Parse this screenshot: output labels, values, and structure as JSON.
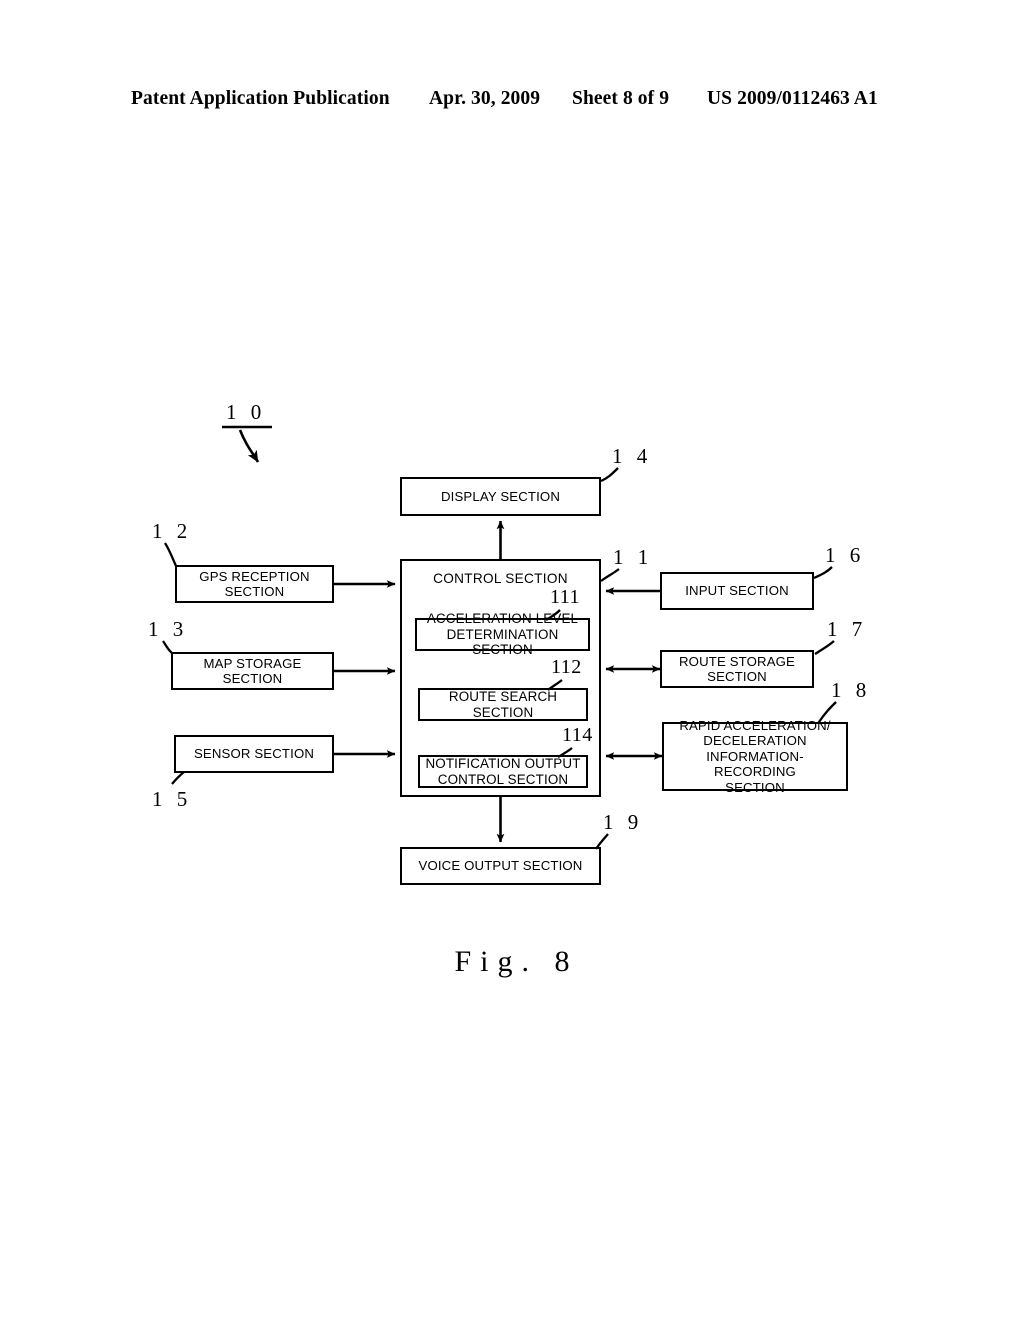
{
  "header": {
    "publication": "Patent Application Publication",
    "date": "Apr. 30, 2009",
    "sheet": "Sheet 8 of 9",
    "number": "US 2009/0112463 A1"
  },
  "figure": {
    "caption": "Fig. 8",
    "system_ref": "1 0"
  },
  "blocks": {
    "display": {
      "label": "DISPLAY SECTION",
      "ref": "1 4"
    },
    "control": {
      "label": "CONTROL SECTION",
      "ref": "1 1"
    },
    "acceleration_level": {
      "label": "ACCELERATION LEVEL\nDETERMINATION SECTION",
      "ref": "111"
    },
    "route_search": {
      "label": "ROUTE SEARCH\nSECTION",
      "ref": "112"
    },
    "notification_output": {
      "label": "NOTIFICATION OUTPUT\nCONTROL SECTION",
      "ref": "114"
    },
    "gps_reception": {
      "label": "GPS RECEPTION\nSECTION",
      "ref": "1 2"
    },
    "map_storage": {
      "label": "MAP STORAGE\nSECTION",
      "ref": "1 3"
    },
    "sensor": {
      "label": "SENSOR SECTION",
      "ref": "1 5"
    },
    "input": {
      "label": "INPUT SECTION",
      "ref": "1 6"
    },
    "route_storage": {
      "label": "ROUTE STORAGE\nSECTION",
      "ref": "1 7"
    },
    "rapid_accel_recording": {
      "label": "RAPID ACCELERATION/\nDECELERATION\nINFORMATION-RECORDING\nSECTION",
      "ref": "1 8"
    },
    "voice_output": {
      "label": "VOICE OUTPUT SECTION",
      "ref": "1 9"
    }
  },
  "colors": {
    "ink": "#000000",
    "paper": "#ffffff"
  }
}
